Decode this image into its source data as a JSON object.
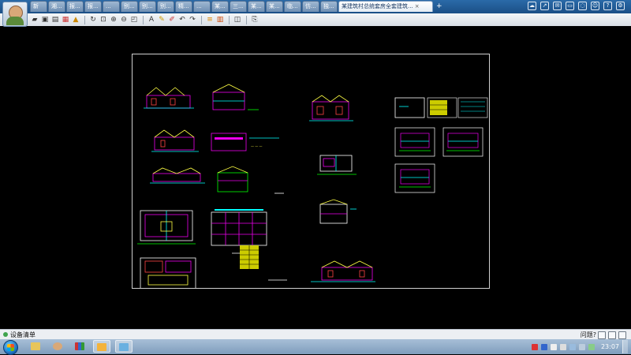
{
  "window": {
    "tabs": [
      {
        "label": "新",
        "active": false
      },
      {
        "label": "湘...",
        "active": false
      },
      {
        "label": "报...",
        "active": false
      },
      {
        "label": "报...",
        "active": false
      },
      {
        "label": "...",
        "active": false
      },
      {
        "label": "别...",
        "active": false
      },
      {
        "label": "别...",
        "active": false
      },
      {
        "label": "别...",
        "active": false
      },
      {
        "label": "精...",
        "active": false
      },
      {
        "label": "...",
        "active": false
      },
      {
        "label": "某...",
        "active": false
      },
      {
        "label": "三...",
        "active": false
      },
      {
        "label": "某...",
        "active": false
      },
      {
        "label": "某...",
        "active": false
      },
      {
        "label": "临...",
        "active": false
      },
      {
        "label": "仿...",
        "active": false
      },
      {
        "label": "独...",
        "active": false
      },
      {
        "label": "某建筑村总统套房全套建筑...",
        "active": true
      }
    ],
    "add_tab_label": "+"
  },
  "toolbar": {
    "icons": [
      "open-icon",
      "save-icon",
      "print-icon",
      "export-pdf-icon",
      "lock-icon",
      "rotate-icon",
      "zoom-window-icon",
      "zoom-in-icon",
      "zoom-out-icon",
      "text-icon",
      "pencil-icon",
      "marker-icon",
      "undo-icon",
      "redo-icon",
      "layer-icon",
      "color-icon",
      "layers-stack-icon",
      "export-icon"
    ]
  },
  "status": {
    "label": "设备清单",
    "help": "问题?"
  },
  "taskbar": {
    "time": "23:07",
    "apps": [
      "folder-app",
      "avatar-app",
      "books-app",
      "paint-app",
      "image-app"
    ]
  },
  "colors": {
    "canvas": "#000000",
    "sheet_border": "#cfcfcf",
    "title_bar": "#1b4f86"
  }
}
